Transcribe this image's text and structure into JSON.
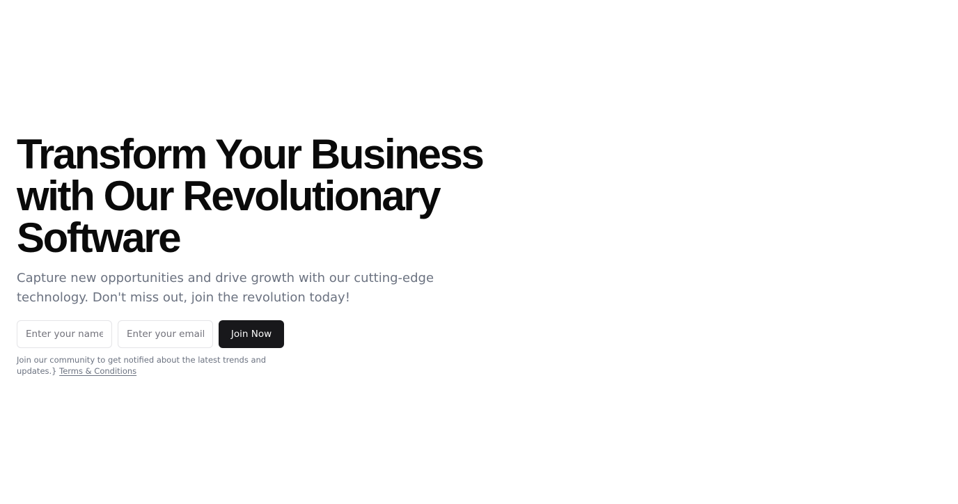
{
  "hero": {
    "headline": "Transform Your Business with Our Revolutionary Software",
    "subtitle": "Capture new opportunities and drive growth with our cutting-edge technology. Don't miss out, join the revolution today!"
  },
  "form": {
    "name_placeholder": "Enter your name",
    "email_placeholder": "Enter your email",
    "submit_label": "Join Now"
  },
  "footnote": {
    "text": "Join our community to get notified about the latest trends and updates.}",
    "link_label": "Terms & Conditions"
  },
  "colors": {
    "headline": "#0a0a0a",
    "muted_text": "#6b7280",
    "button_bg": "#18181b",
    "button_text": "#fafafa",
    "input_border": "#e4e4e7"
  }
}
